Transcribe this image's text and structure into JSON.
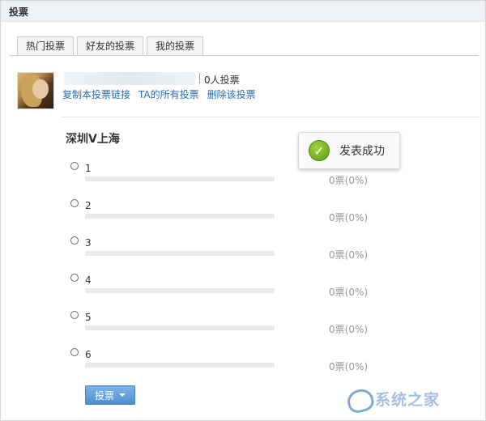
{
  "header": {
    "title": "投票"
  },
  "tabs": [
    {
      "label": "热门投票"
    },
    {
      "label": "好友的投票"
    },
    {
      "label": "我的投票"
    }
  ],
  "poll_meta": {
    "vote_count": "0人投票",
    "links": [
      "复制本投票链接",
      "TA的所有投票",
      "删除该投票"
    ]
  },
  "poll": {
    "title": "深圳V上海",
    "options": [
      {
        "label": "1",
        "result": "0票(0%)",
        "share": 0
      },
      {
        "label": "2",
        "result": "0票(0%)",
        "share": 0
      },
      {
        "label": "3",
        "result": "0票(0%)",
        "share": 0
      },
      {
        "label": "4",
        "result": "0票(0%)",
        "share": 0
      },
      {
        "label": "5",
        "result": "0票(0%)",
        "share": 0
      },
      {
        "label": "6",
        "result": "0票(0%)",
        "share": 0
      }
    ],
    "vote_button": "投票"
  },
  "toast": {
    "text": "发表成功",
    "icon": "check-icon"
  },
  "watermark": {
    "text": "系统之家"
  },
  "colors": {
    "link": "#2a6bb0",
    "button": "#4f8fd0",
    "success": "#6aa81a"
  }
}
